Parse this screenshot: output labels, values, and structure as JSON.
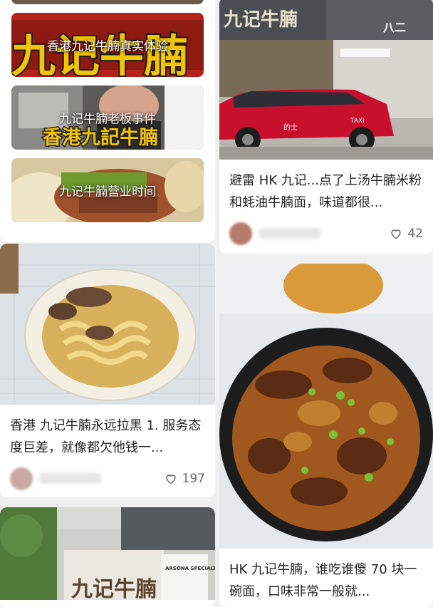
{
  "feed": {
    "collection_card": {
      "tiles": [
        {
          "label": "香港九记牛腩真实体验"
        },
        {
          "label": "九记牛腩老板事件"
        },
        {
          "label": "九记牛腩营业时间"
        }
      ]
    },
    "posts": [
      {
        "title": "避雷 HK 九记...点了上汤牛腩米粉和蚝油牛腩面，味道都很...",
        "likes": "42"
      },
      {
        "title": "香港 九记牛腩永远拉黑 1. 服务态度巨差，就像都欠他钱一...",
        "likes": "197"
      },
      {
        "title": "HK 九记牛腩，谁吃谁傻 70 块一碗面，口味非常一般就..."
      }
    ],
    "image_text": {
      "shop_sign": "九记牛腩",
      "shop_sign_2": "八二",
      "taxi_plate": "的士",
      "taxi_roof": "TAXI",
      "tile1_banner": "九记牛腩",
      "tile2_banner": "香港九記牛腩",
      "store_sign": "ARSONA SPECIALTY STORE"
    }
  }
}
